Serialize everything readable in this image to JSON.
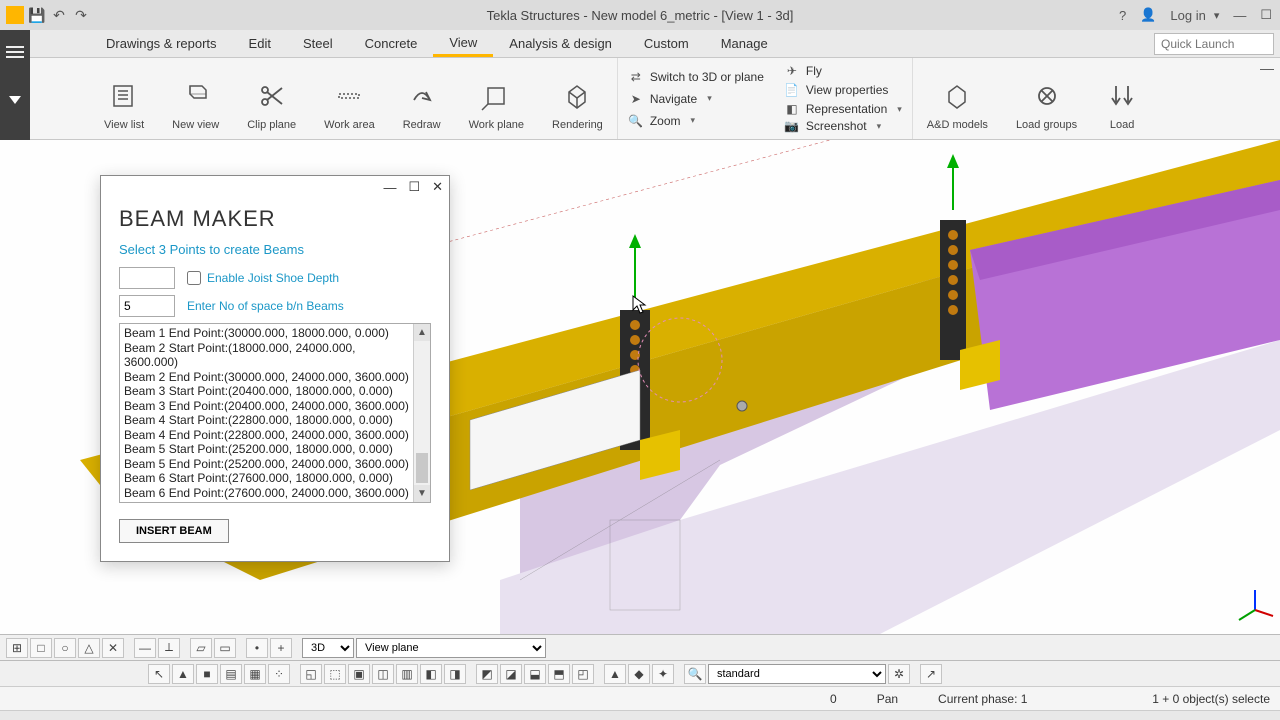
{
  "title": "Tekla Structures - New model 6_metric - [View 1 - 3d]",
  "login": "Log in",
  "quick_launch_placeholder": "Quick Launch",
  "tabs": [
    "Drawings & reports",
    "Edit",
    "Steel",
    "Concrete",
    "View",
    "Analysis & design",
    "Custom",
    "Manage"
  ],
  "active_tab": 4,
  "ribbon": {
    "view_list": "View list",
    "new_view": "New view",
    "clip_plane": "Clip plane",
    "work_area": "Work area",
    "redraw": "Redraw",
    "work_plane": "Work plane",
    "rendering": "Rendering",
    "switch": "Switch to 3D or plane",
    "navigate": "Navigate",
    "zoom": "Zoom",
    "fly": "Fly",
    "view_props": "View properties",
    "representation": "Representation",
    "screenshot": "Screenshot",
    "ad_models": "A&D models",
    "load_groups": "Load groups",
    "load": "Load"
  },
  "dialog": {
    "title": "BEAM MAKER",
    "prompt": "Select 3 Points to create Beams",
    "enable_joist": "Enable Joist Shoe Depth",
    "enter_spaces": "Enter No of space b/n Beams",
    "spaces_value": "5",
    "depth_value": "",
    "list": [
      "Beam 1 End Point:(30000.000, 18000.000, 0.000)",
      "Beam 2 Start Point:(18000.000, 24000.000, 3600.000)",
      "Beam 2 End Point:(30000.000, 24000.000, 3600.000)",
      "Beam 3 Start Point:(20400.000, 18000.000, 0.000)",
      "Beam 3 End Point:(20400.000, 24000.000, 3600.000)",
      "Beam 4 Start Point:(22800.000, 18000.000, 0.000)",
      "Beam 4 End Point:(22800.000, 24000.000, 3600.000)",
      "Beam 5 Start Point:(25200.000, 18000.000, 0.000)",
      "Beam 5 End Point:(25200.000, 24000.000, 3600.000)",
      "Beam 6 Start Point:(27600.000, 18000.000, 0.000)",
      "Beam 6 End Point:(27600.000, 24000.000, 3600.000)"
    ],
    "insert": "INSERT BEAM"
  },
  "tb1": {
    "sel3d": "3D",
    "viewplane": "View plane"
  },
  "tb2": {
    "standard": "standard"
  },
  "status": {
    "zero": "0",
    "pan": "Pan",
    "phase": "Current phase: 1",
    "objects": "1 + 0 object(s) selecte"
  }
}
